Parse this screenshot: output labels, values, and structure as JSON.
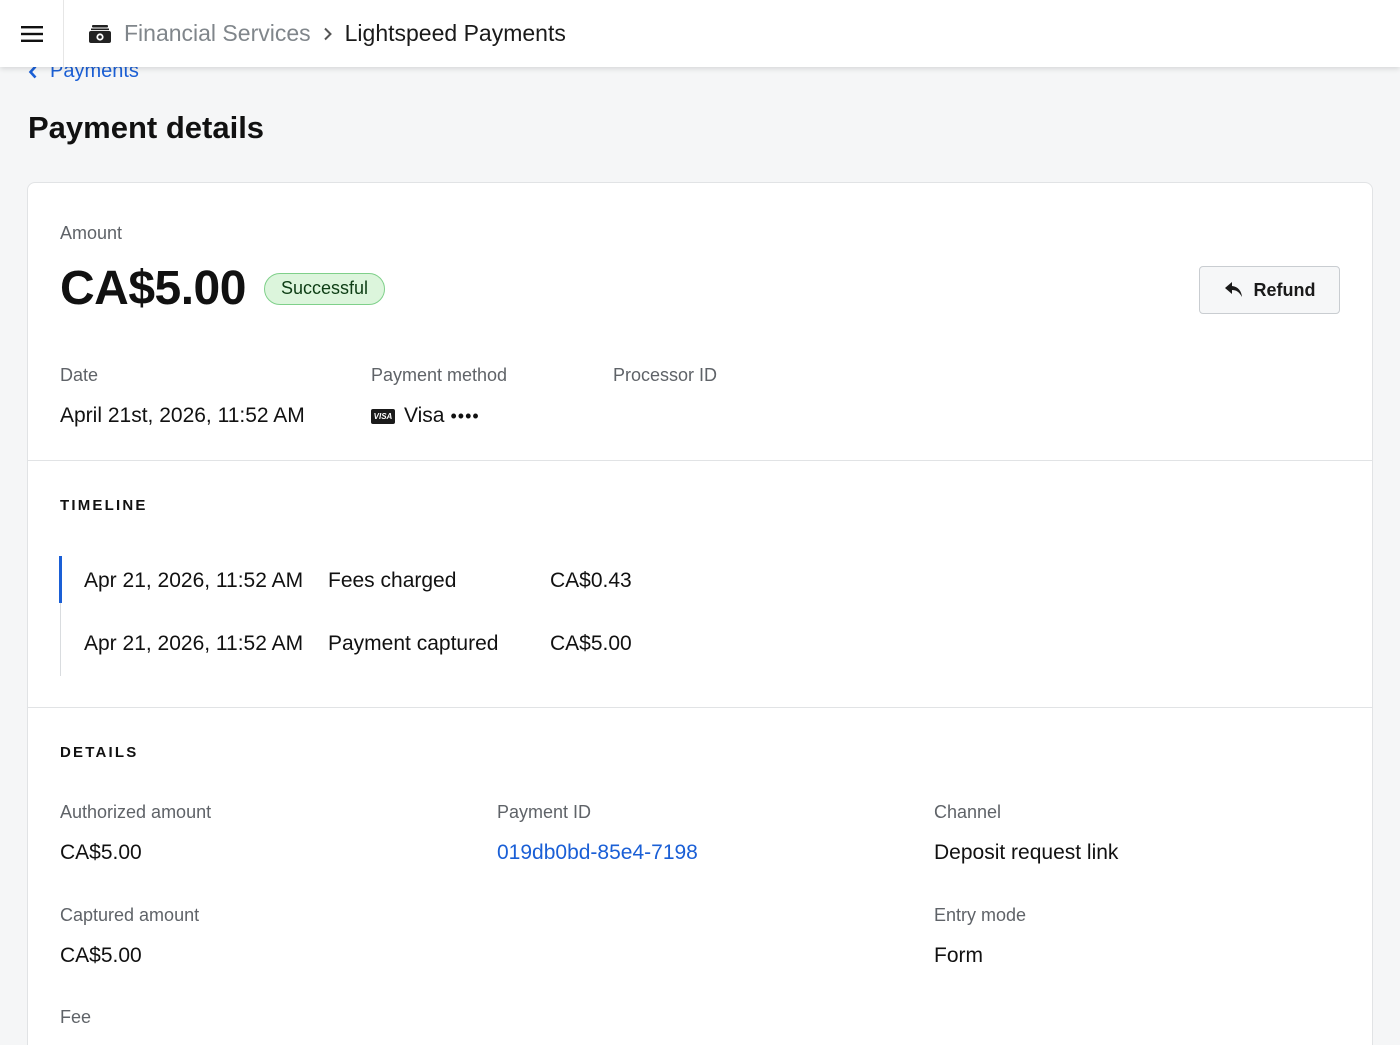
{
  "topbar": {
    "breadcrumb_parent": "Financial Services",
    "breadcrumb_current": "Lightspeed Payments"
  },
  "back_link": {
    "label": "Payments"
  },
  "page": {
    "title": "Payment details"
  },
  "summary": {
    "amount_label": "Amount",
    "amount_value": "CA$5.00",
    "status": "Successful",
    "refund_label": "Refund",
    "date_label": "Date",
    "date_value": "April 21st, 2026, 11:52 AM",
    "payment_method_label": "Payment method",
    "payment_method_brand": "Visa",
    "payment_method_mask": "••••",
    "card_icon_text": "VISA",
    "processor_id_label": "Processor ID"
  },
  "timeline": {
    "heading": "TIMELINE",
    "events": [
      {
        "date": "Apr 21, 2026, 11:52 AM",
        "event": "Fees charged",
        "amount": "CA$0.43"
      },
      {
        "date": "Apr 21, 2026, 11:52 AM",
        "event": "Payment captured",
        "amount": "CA$5.00"
      }
    ]
  },
  "details": {
    "heading": "DETAILS",
    "authorized_amount_label": "Authorized amount",
    "authorized_amount_value": "CA$5.00",
    "payment_id_label": "Payment ID",
    "payment_id_value": "019db0bd-85e4-7198",
    "channel_label": "Channel",
    "channel_value": "Deposit request link",
    "captured_amount_label": "Captured amount",
    "captured_amount_value": "CA$5.00",
    "entry_mode_label": "Entry mode",
    "entry_mode_value": "Form",
    "fee_label": "Fee"
  },
  "colors": {
    "accent": "#1a5fd6",
    "success_bg": "#dcf5dc",
    "success_border": "#7fd08a"
  },
  "icons": {
    "menu": "hamburger-menu-icon",
    "breadcrumb": "cash-register-icon",
    "separator": "chevron-right-icon",
    "back": "chevron-left-icon",
    "refund": "reply-arrow-icon",
    "card": "visa-card-icon"
  }
}
